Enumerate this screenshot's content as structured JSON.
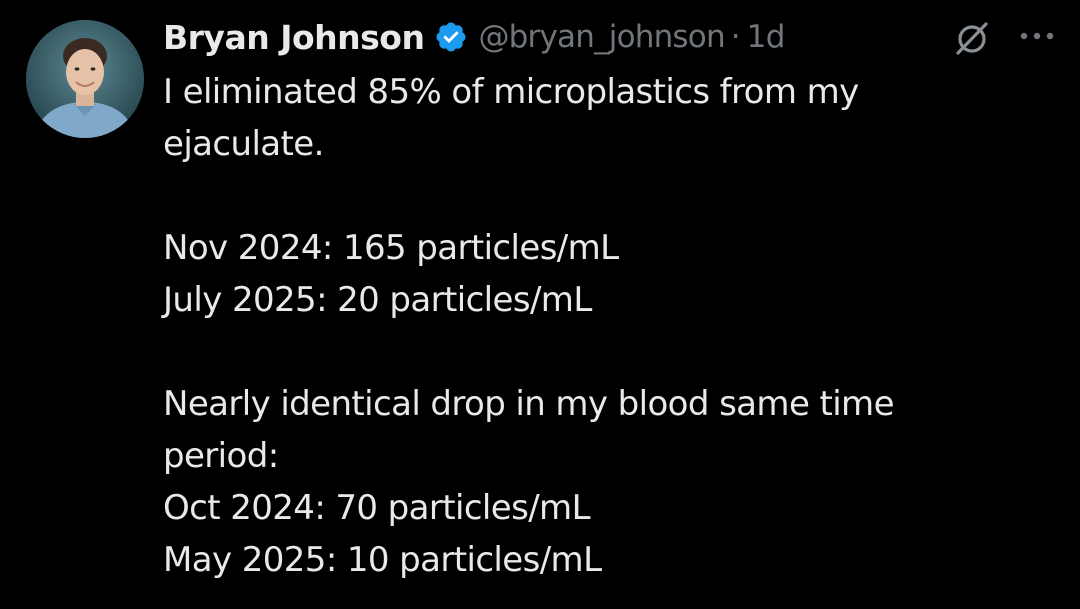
{
  "author": {
    "display_name": "Bryan Johnson",
    "handle": "@bryan_johnson",
    "separator": "·",
    "timestamp": "1d",
    "verified": true,
    "verified_color": "#1d9bf0"
  },
  "tweet": {
    "lines": [
      "I eliminated 85% of microplastics from my",
      "ejaculate.",
      "",
      "Nov 2024: 165 particles/mL",
      "July 2025: 20 particles/mL",
      "",
      "Nearly identical drop in my blood same time",
      "period:",
      "Oct 2024: 70 particles/mL",
      "May 2025: 10 particles/mL"
    ]
  },
  "icons": {
    "grok": "grok-icon",
    "more": "more-options-icon",
    "verified": "verified-badge-icon"
  },
  "colors": {
    "background": "#000000",
    "text": "#e7e9ea",
    "secondary_text": "#71767b"
  }
}
